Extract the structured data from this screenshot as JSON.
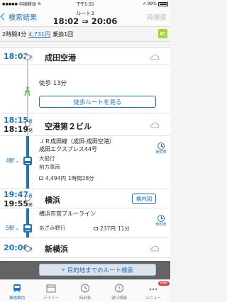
{
  "status_bar": {
    "carrier": "中国移动",
    "time": "下午5:55",
    "battery": "99%"
  },
  "nav": {
    "back_label": "検索結果",
    "route_name": "ルート3",
    "route_time": "18:02 ⇒ 20:06",
    "research_label": "再検索"
  },
  "summary": {
    "duration": "2時間4分",
    "fare": "4,731円",
    "transfers": "乗換1回",
    "badge": "IC"
  },
  "stations": [
    {
      "time": "18:02",
      "suffix": "発",
      "name": "成田空港"
    },
    {
      "time": "18:15",
      "suffix": "着",
      "time2": "18:19",
      "suffix2": "発",
      "name": "空港第２ビル"
    },
    {
      "time": "19:47",
      "suffix": "着",
      "time2": "19:55",
      "suffix2": "発",
      "name": "横浜"
    },
    {
      "time": "20:06",
      "suffix": "着",
      "name": "新横浜"
    }
  ],
  "walk": {
    "text": "徒歩 13分",
    "button": "徒歩ルートを見る"
  },
  "segment1": {
    "line": "ＪＲ成田線（成田-成田空港）",
    "train": "成田エクスプレス44号",
    "destination": "大船行",
    "car": "前方車両",
    "fare": "4,494円",
    "duration": "1時間28分",
    "stops": "4駅",
    "clock_label": "時刻表"
  },
  "yokohama": {
    "map_button": "構内図"
  },
  "segment2": {
    "line": "横浜市営ブルーライン",
    "destination": "あざみ野行",
    "fare": "237円",
    "duration": "11分",
    "stops": "5駅",
    "clock_label": "時刻表"
  },
  "banner": {
    "label": "目的地までのルート検索"
  },
  "tabs": [
    {
      "label": "乗換案内",
      "active": true
    },
    {
      "label": "デイリー"
    },
    {
      "label": "時刻表"
    },
    {
      "label": "運行情報"
    },
    {
      "label": "メニュー",
      "badge": "new"
    }
  ],
  "colors": {
    "accent": "#1a73c8",
    "badge_green": "#a5d62e"
  }
}
